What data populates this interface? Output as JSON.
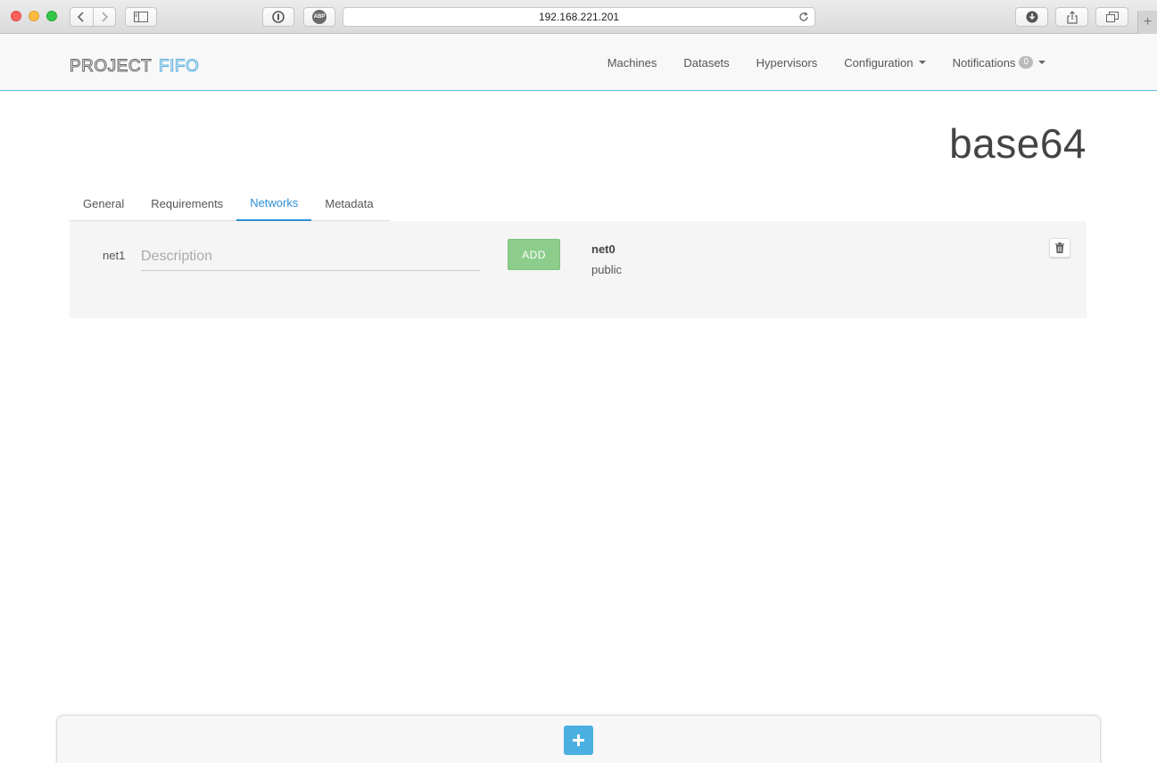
{
  "browser": {
    "url": "192.168.221.201",
    "extension_abp_label": "ABP"
  },
  "navbar": {
    "brand_part1": "PROJECT",
    "brand_part2": "FIFO",
    "links": {
      "machines": "Machines",
      "datasets": "Datasets",
      "hypervisors": "Hypervisors",
      "configuration": "Configuration",
      "notifications": "Notifications"
    },
    "notification_count": "0"
  },
  "page": {
    "title": "base64"
  },
  "tabs": {
    "general": "General",
    "requirements": "Requirements",
    "networks": "Networks",
    "metadata": "Metadata",
    "active": "Networks"
  },
  "networks_form": {
    "new_net_label": "net1",
    "description_placeholder": "Description",
    "description_value": "",
    "add_label": "ADD"
  },
  "networks": [
    {
      "name": "net0",
      "description": "public"
    }
  ],
  "colors": {
    "accent": "#2c8fd6",
    "navbar_border": "#5bc0de",
    "add_button": "#8ccd8c",
    "plus_button": "#4ab0e2",
    "brand_fifo": "#5aaedc"
  }
}
